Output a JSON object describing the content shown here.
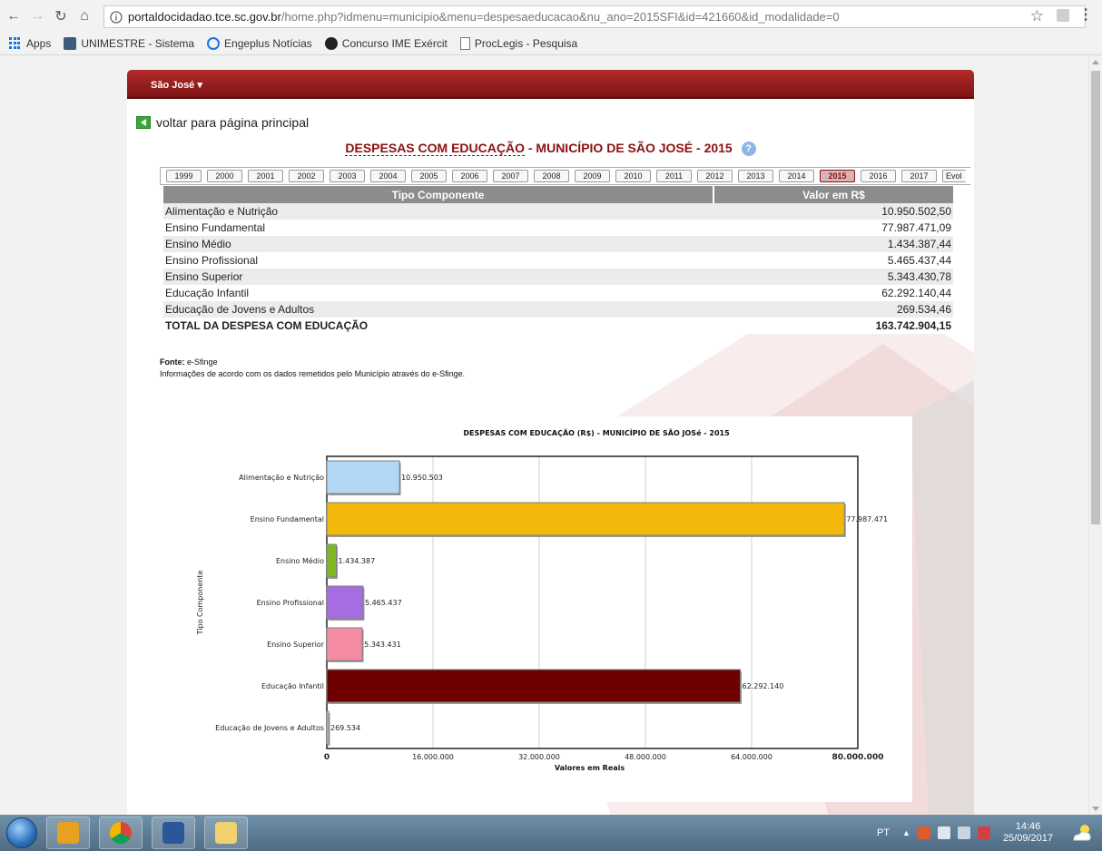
{
  "browser": {
    "url_host": "portaldocidadao.tce.sc.gov.br",
    "url_path": "/home.php?idmenu=municipio&menu=despesaeducacao&nu_ano=2015SFI&id=421660&id_modalidade=0"
  },
  "bookmarks": [
    "Apps",
    "UNIMESTRE - Sistema",
    "Engeplus Notícias",
    "Concurso IME Exércit",
    "ProcLegis - Pesquisa"
  ],
  "header": {
    "city_menu": "São José"
  },
  "page": {
    "back_link": "voltar para página principal",
    "title_main": "DESPESAS COM EDUCAÇÃO",
    "title_rest": " - MUNICÍPIO DE SÃO JOSÉ - 2015",
    "help_icon": "?"
  },
  "years": [
    "1999",
    "2000",
    "2001",
    "2002",
    "2003",
    "2004",
    "2005",
    "2006",
    "2007",
    "2008",
    "2009",
    "2010",
    "2011",
    "2012",
    "2013",
    "2014",
    "2015",
    "2016",
    "2017",
    "Evol"
  ],
  "active_year": "2015",
  "table": {
    "headers": [
      "Tipo Componente",
      "Valor em R$"
    ],
    "rows": [
      [
        "Alimentação e Nutrição",
        "10.950.502,50"
      ],
      [
        "Ensino Fundamental",
        "77.987.471,09"
      ],
      [
        "Ensino Médio",
        "1.434.387,44"
      ],
      [
        "Ensino Profissional",
        "5.465.437,44"
      ],
      [
        "Ensino Superior",
        "5.343.430,78"
      ],
      [
        "Educação Infantil",
        "62.292.140,44"
      ],
      [
        "Educação de Jovens e Adultos",
        "269.534,46"
      ]
    ],
    "total_label": "TOTAL DA DESPESA COM EDUCAÇÃO",
    "total_value": "163.742.904,15"
  },
  "source": {
    "label": "Fonte:",
    "value": " e-Sfinge",
    "note": "Informações de acordo com os dados remetidos pelo Município através do e-Sfinge."
  },
  "chart_data": {
    "type": "bar",
    "orientation": "horizontal",
    "title": "DESPESAS COM EDUCAÇÃO (R$) - MUNICÍPIO DE SÃO JOSé - 2015",
    "xlabel": "Valores em Reais",
    "ylabel": "Tipo Componente",
    "categories": [
      "Alimentação e Nutrição",
      "Ensino Fundamental",
      "Ensino Médio",
      "Ensino Profissional",
      "Ensino Superior",
      "Educação Infantil",
      "Educação de Jovens e Adultos"
    ],
    "values": [
      10950503,
      77987471,
      1434387,
      5465437,
      5343431,
      62292140,
      269534
    ],
    "value_labels": [
      "10.950.503",
      "77.987.471",
      "1.434.387",
      "5.465.437",
      "5.343.431",
      "62.292.140",
      "269.534"
    ],
    "colors": [
      "#b3d8f6",
      "#f2b90c",
      "#7fb823",
      "#a56de0",
      "#f48ca4",
      "#6e0000",
      "#cfcfcf"
    ],
    "xlim": [
      0,
      80000000
    ],
    "xticks": [
      0,
      16000000,
      32000000,
      48000000,
      64000000,
      80000000
    ],
    "xtick_labels": [
      "0",
      "16.000.000",
      "32.000.000",
      "48.000.000",
      "64.000.000",
      "80.000.000"
    ],
    "grid": true
  },
  "taskbar": {
    "lang": "PT",
    "time": "14:46",
    "date": "25/09/2017"
  }
}
